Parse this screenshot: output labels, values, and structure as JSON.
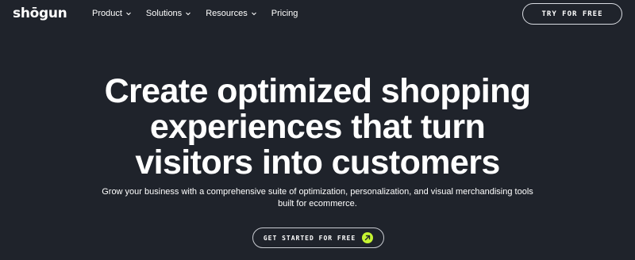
{
  "brand": {
    "logo_text": "shōgun"
  },
  "nav": {
    "items": [
      {
        "label": "Product",
        "has_dropdown": true
      },
      {
        "label": "Solutions",
        "has_dropdown": true
      },
      {
        "label": "Resources",
        "has_dropdown": true
      },
      {
        "label": "Pricing",
        "has_dropdown": false
      }
    ],
    "cta_label": "TRY FOR FREE"
  },
  "hero": {
    "title_lines": [
      "Create optimized shopping",
      "experiences that turn",
      "visitors into customers"
    ],
    "subtitle_lines": [
      "Grow your business with a comprehensive suite of optimization, personalization, and visual merchandising tools",
      "built for ecommerce."
    ],
    "cta_label": "GET STARTED FOR FREE",
    "cta_icon": "arrow-up-right-icon"
  },
  "colors": {
    "background": "#1f232b",
    "text": "#ffffff",
    "accent": "#c6f432"
  }
}
